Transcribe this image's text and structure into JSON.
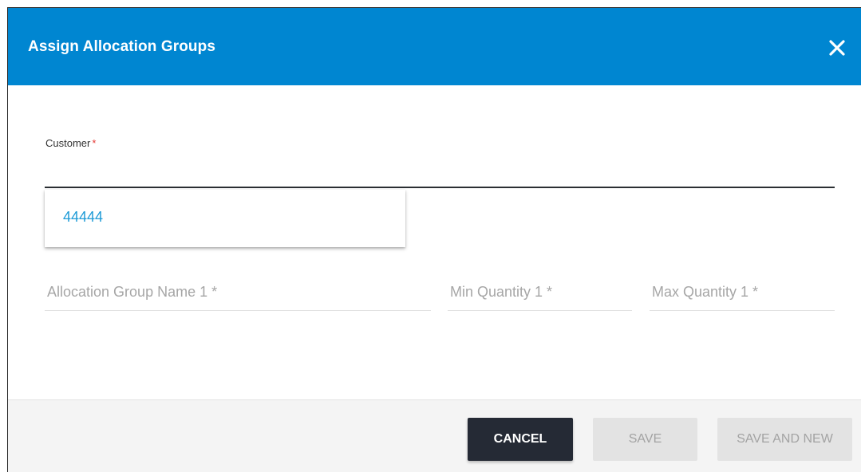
{
  "dialog": {
    "title": "Assign Allocation Groups",
    "close_icon": "close-icon",
    "header_color": "#0086d1"
  },
  "customer": {
    "label": "Customer",
    "required_marker": "*",
    "value": "",
    "suggestions": [
      "44444"
    ]
  },
  "fields": [
    {
      "label": "Allocation Group Name 1 *"
    },
    {
      "label": "Min Quantity 1 *"
    },
    {
      "label": "Max Quantity 1 *"
    }
  ],
  "buttons": {
    "cancel": "CANCEL",
    "save": "SAVE",
    "save_and_new": "SAVE AND NEW"
  }
}
